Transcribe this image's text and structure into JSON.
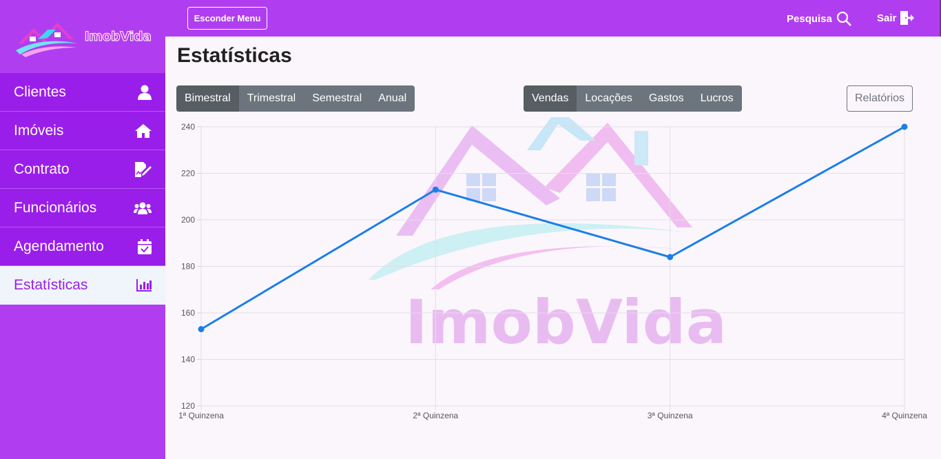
{
  "brand": {
    "name": "ImobVida"
  },
  "sidebar": {
    "items": [
      {
        "label": "Clientes",
        "icon": "user-icon",
        "active": false
      },
      {
        "label": "Imóveis",
        "icon": "home-icon",
        "active": false
      },
      {
        "label": "Contrato",
        "icon": "contract-icon",
        "active": false
      },
      {
        "label": "Funcionários",
        "icon": "users-icon",
        "active": false
      },
      {
        "label": "Agendamento",
        "icon": "calendar-check-icon",
        "active": false
      },
      {
        "label": "Estatísticas",
        "icon": "bar-chart-icon",
        "active": true
      }
    ]
  },
  "topbar": {
    "menu_button": "Esconder Menu",
    "search_label": "Pesquisa",
    "logout_label": "Sair"
  },
  "main": {
    "title": "Estatísticas",
    "period_tabs": [
      "Bimestral",
      "Trimestral",
      "Semestral",
      "Anual"
    ],
    "period_selected": "Bimestral",
    "metric_tabs": [
      "Vendas",
      "Locações",
      "Gastos",
      "Lucros"
    ],
    "metric_selected": "Vendas",
    "report_button": "Relatórios"
  },
  "colors": {
    "sidebar": "#b03ef0",
    "nav_item": "#9a1ee9",
    "active_bg": "#f0f4fb",
    "line": "#1a7fe8",
    "button_secondary": "#6c757d"
  },
  "chart_data": {
    "type": "line",
    "categories": [
      "1ª Quinzena",
      "2ª Quinzena",
      "3ª Quinzena",
      "4ª Quinzena"
    ],
    "series": [
      {
        "values": [
          153,
          213,
          184,
          240
        ]
      }
    ],
    "yticks": [
      120,
      140,
      160,
      180,
      200,
      220,
      240
    ],
    "ylim": [
      120,
      240
    ],
    "grid": true,
    "watermark": "ImobVida"
  }
}
